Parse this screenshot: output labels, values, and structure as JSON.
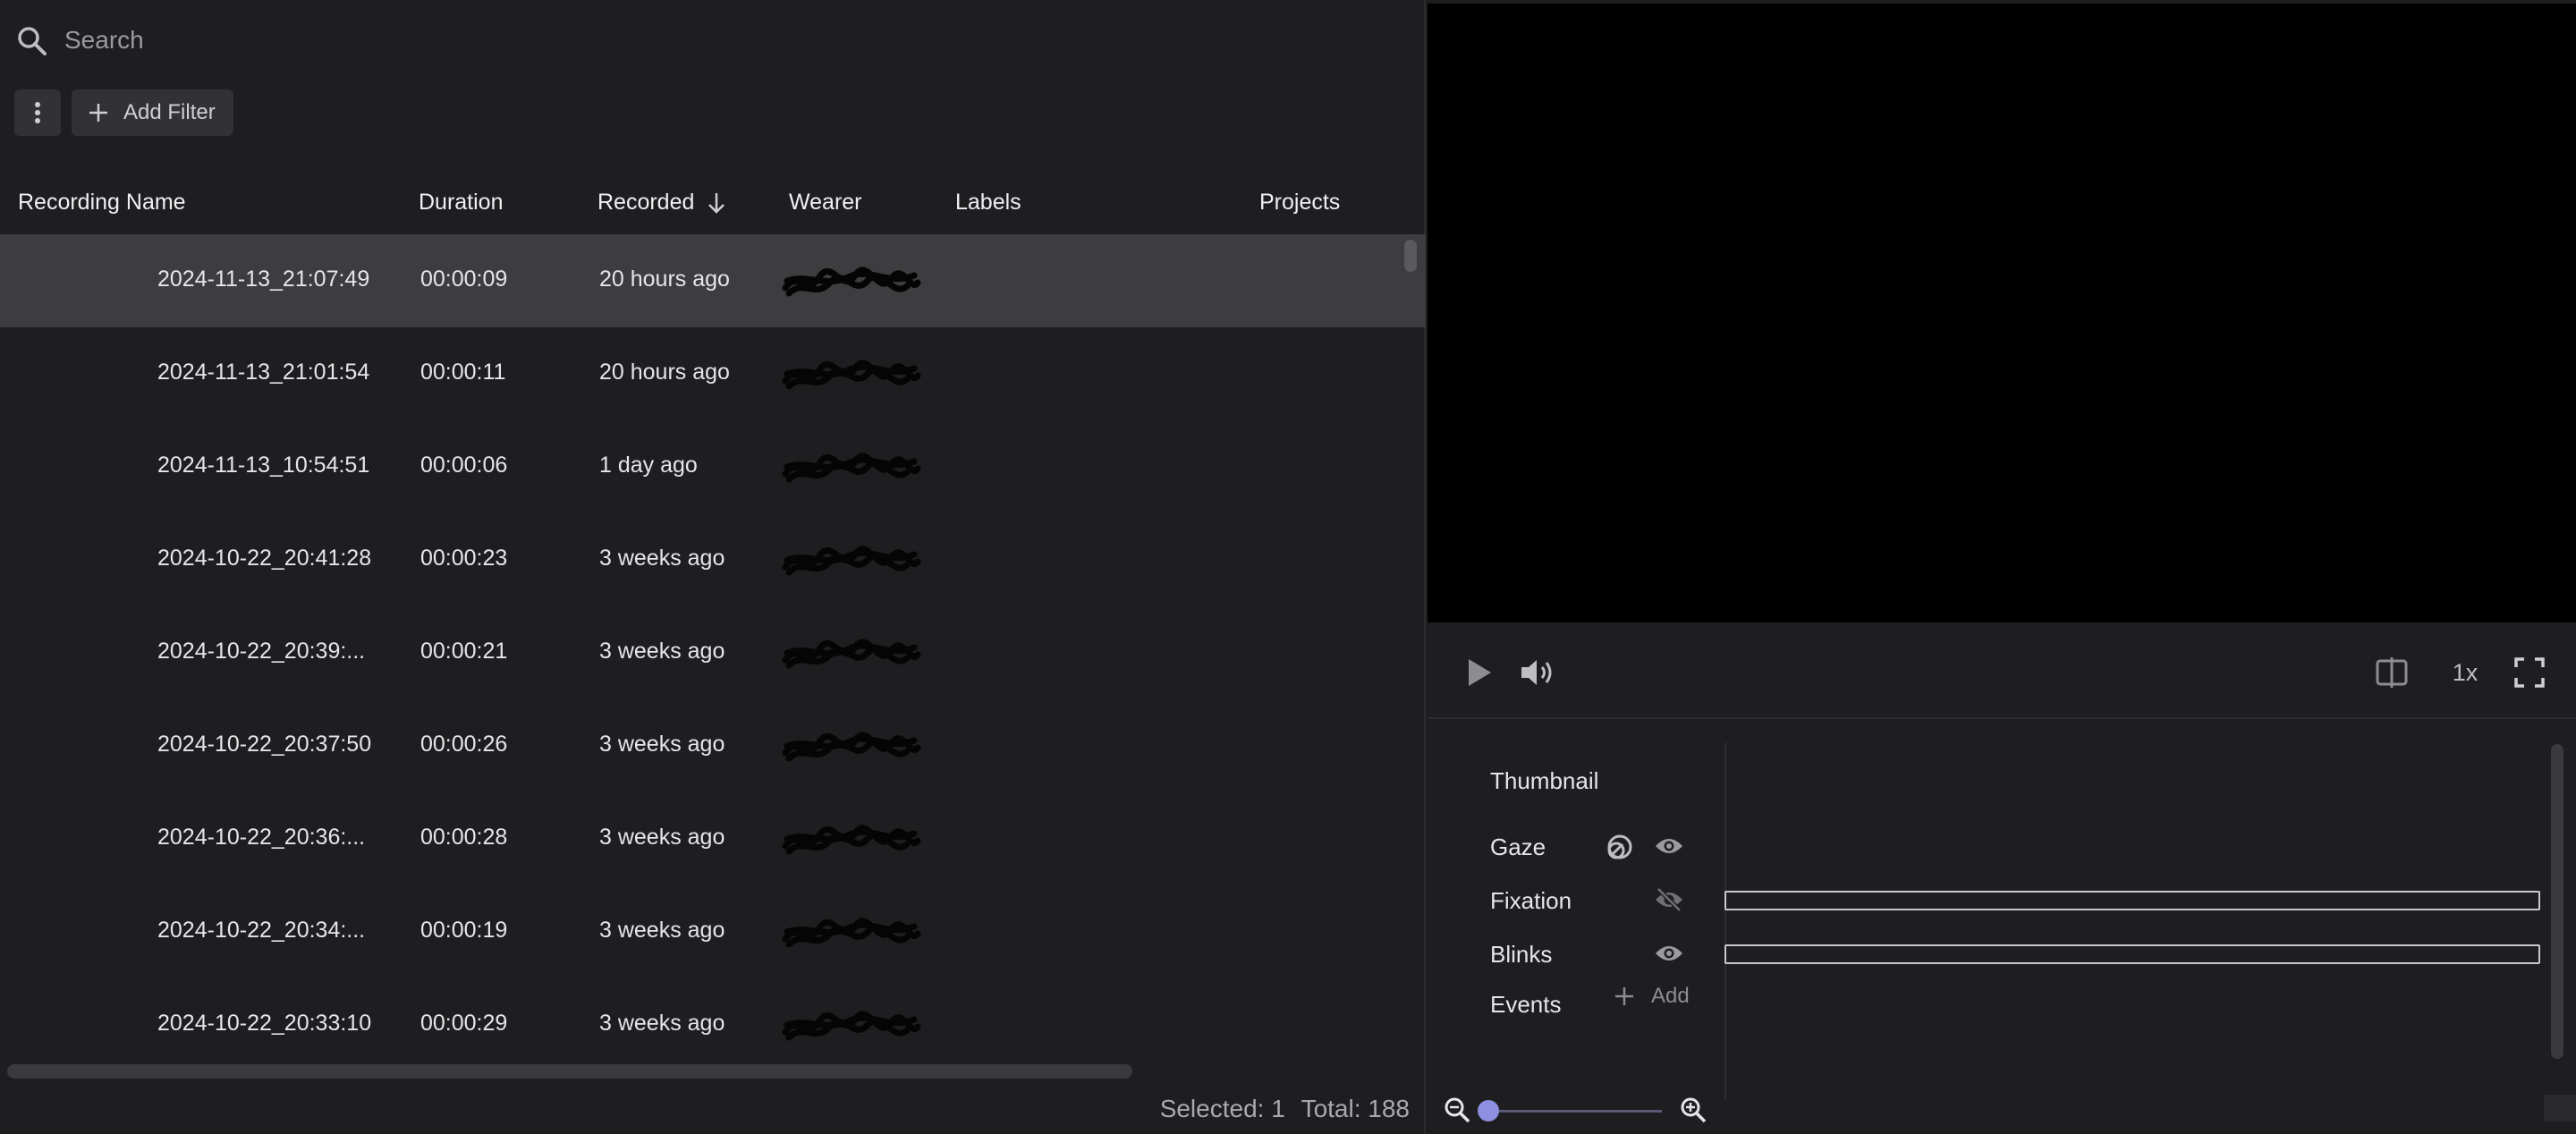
{
  "search": {
    "placeholder": "Search"
  },
  "filters": {
    "add_filter_label": "Add Filter"
  },
  "table": {
    "columns": {
      "recording_name": "Recording Name",
      "duration": "Duration",
      "recorded": "Recorded",
      "wearer": "Wearer",
      "labels": "Labels",
      "projects": "Projects"
    },
    "rows": [
      {
        "name": "2024-11-13_21:07:49",
        "duration": "00:00:09",
        "recorded": "20 hours ago",
        "selected": true
      },
      {
        "name": "2024-11-13_21:01:54",
        "duration": "00:00:11",
        "recorded": "20 hours ago",
        "selected": false
      },
      {
        "name": "2024-11-13_10:54:51",
        "duration": "00:00:06",
        "recorded": "1 day ago",
        "selected": false
      },
      {
        "name": "2024-10-22_20:41:28",
        "duration": "00:00:23",
        "recorded": "3 weeks ago",
        "selected": false
      },
      {
        "name": "2024-10-22_20:39:...",
        "duration": "00:00:21",
        "recorded": "3 weeks ago",
        "selected": false
      },
      {
        "name": "2024-10-22_20:37:50",
        "duration": "00:00:26",
        "recorded": "3 weeks ago",
        "selected": false
      },
      {
        "name": "2024-10-22_20:36:...",
        "duration": "00:00:28",
        "recorded": "3 weeks ago",
        "selected": false
      },
      {
        "name": "2024-10-22_20:34:...",
        "duration": "00:00:19",
        "recorded": "3 weeks ago",
        "selected": false
      },
      {
        "name": "2024-10-22_20:33:10",
        "duration": "00:00:29",
        "recorded": "3 weeks ago",
        "selected": false
      }
    ]
  },
  "status": {
    "selected": "Selected: 1",
    "total": "Total: 188"
  },
  "player": {
    "speed": "1x"
  },
  "timeline": {
    "thumbnail": "Thumbnail",
    "gaze": "Gaze",
    "fixation": "Fixation",
    "blinks": "Blinks",
    "events": "Events",
    "add_event": "Add"
  },
  "colors": {
    "accent": "#8d8fe0",
    "selected_row": "#3d3d40",
    "background": "#1e1e20"
  },
  "icons": [
    "search-icon",
    "kebab-icon",
    "plus-icon",
    "arrow-down-icon",
    "play-icon",
    "volume-icon",
    "split-view-icon",
    "fullscreen-icon",
    "gaze-overlay-icon",
    "eye-icon",
    "eye-off-icon",
    "zoom-out-icon",
    "zoom-in-icon"
  ]
}
